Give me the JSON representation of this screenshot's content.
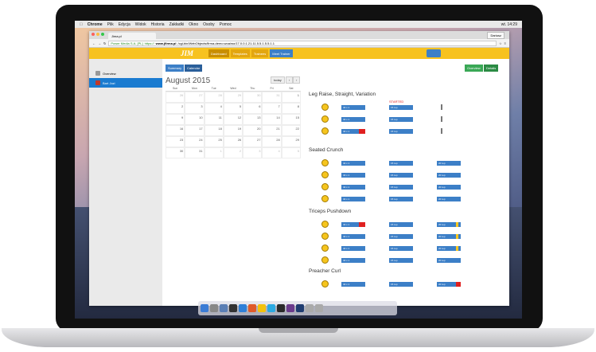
{
  "menubar": {
    "app": "Chrome",
    "items": [
      "Plik",
      "Edycja",
      "Widok",
      "Historia",
      "Zakładki",
      "Okno",
      "Osoby",
      "Pomoc"
    ],
    "clock": "wt. 14:29"
  },
  "browser": {
    "tab_title": "Jima.pl",
    "user_button": "Dariusz",
    "url_owner": "Power Media S.A. [PL]",
    "url_prefix": "https://",
    "url_host": "www.jfirma.pl",
    "url_rest": "/cgi-bin/WebObjects/firma-demo.woa/wo/17.0.0.1.21.11.5.5.1.5.5.1.1"
  },
  "app": {
    "logo": "JIM",
    "nav": [
      "Dashboard",
      "Templates",
      "Trainees",
      "Meet Trainer"
    ]
  },
  "sidebar": {
    "items": [
      "Overview",
      "Bart Jozi"
    ]
  },
  "toolbar": {
    "summary": "Summary",
    "calendar": "Calendar",
    "overview": "Overview",
    "details": "Details",
    "today": "today"
  },
  "calendar": {
    "month": "August 2015",
    "days": [
      "Sun",
      "Mon",
      "Tue",
      "Wed",
      "Thu",
      "Fri",
      "Sat"
    ],
    "cells": [
      "26",
      "27",
      "28",
      "29",
      "30",
      "31",
      "1",
      "2",
      "3",
      "4",
      "5",
      "6",
      "7",
      "8",
      "9",
      "10",
      "11",
      "12",
      "13",
      "14",
      "15",
      "16",
      "17",
      "18",
      "19",
      "20",
      "21",
      "22",
      "23",
      "24",
      "25",
      "26",
      "27",
      "28",
      "29",
      "30",
      "31",
      "1",
      "2",
      "3",
      "4",
      "5"
    ]
  },
  "exercises": [
    {
      "name": "Leg Raise, Straight, Variation",
      "status": "STARTED"
    },
    {
      "name": "Seated Crunch"
    },
    {
      "name": "Triceps Pushdown"
    },
    {
      "name": "Preacher Curl"
    }
  ],
  "set_labels": {
    "reps1": "40 x 1",
    "reps2": "15 rep",
    "reps3": "20 rep",
    "reps4": "4 rep"
  }
}
